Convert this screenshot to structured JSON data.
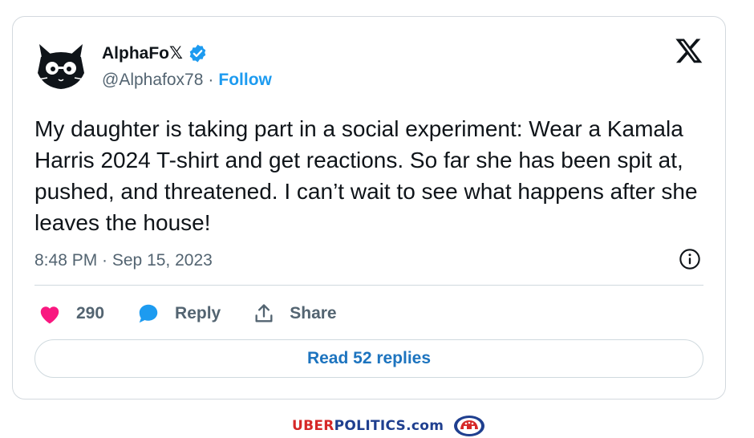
{
  "tweet": {
    "author": {
      "display_name": "AlphaFo𝕏",
      "handle": "@Alphafox78",
      "separator": "·",
      "follow_label": "Follow",
      "verified": true,
      "avatar_icon": "cat-with-glasses-avatar"
    },
    "platform_logo": "x-logo-icon",
    "text": "My daughter is taking part in a social experiment: Wear a Kamala Harris 2024 T-shirt and get reactions. So far she has been spit at, pushed, and threatened. I can’t wait to see what happens after she leaves the house!",
    "timestamp": "8:48 PM · Sep 15, 2023",
    "actions": {
      "likes_count": "290",
      "reply_label": "Reply",
      "share_label": "Share"
    },
    "read_replies_label": "Read 52 replies"
  },
  "watermark": {
    "red_part": "UBER",
    "blue_part": "POLITICS.com"
  },
  "colors": {
    "accent_blue": "#1d9bf0",
    "like_pink": "#f91880",
    "reply_blue": "#1d9bf0",
    "text_dark": "#0f1419",
    "text_gray": "#536471",
    "watermark_red": "#d62828",
    "watermark_blue": "#1f3f8f"
  }
}
